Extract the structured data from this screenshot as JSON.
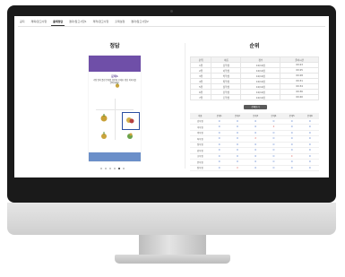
{
  "tabs": [
    {
      "label": "공지"
    },
    {
      "label": "제목/참고사항"
    },
    {
      "label": "출제정답"
    },
    {
      "label": "결과/참고사항1"
    },
    {
      "label": "제작/참고사항"
    },
    {
      "label": "출제설정"
    },
    {
      "label": "결과/참고사항2"
    }
  ],
  "left_panel": {
    "title": "정답",
    "question_title": "문제1",
    "question_text": "가장 많이 틀린 문제를 확인해 보세요. 정답 이미지를 선택하세요."
  },
  "right_panel": {
    "title": "순위",
    "rank_headers": [
      "순위",
      "이름",
      "점수",
      "풀이시간"
    ],
    "rank_rows": [
      [
        "1위",
        "김학생",
        "10/10점",
        "00:23"
      ],
      [
        "2위",
        "이학생",
        "10/10점",
        "00:25"
      ],
      [
        "3위",
        "박학생",
        "10/10점",
        "00:28"
      ],
      [
        "4위",
        "최학생",
        "10/10점",
        "00:31"
      ],
      [
        "5위",
        "정학생",
        "10/10점",
        "00:34"
      ],
      [
        "6위",
        "강학생",
        "10/10점",
        "00:36"
      ],
      [
        "7위",
        "조학생",
        "10/10점",
        "00:40"
      ]
    ],
    "more_button": "전체보기",
    "result_headers": [
      "이름",
      "문제1",
      "문제2",
      "문제3",
      "문제4",
      "문제5",
      "문제6"
    ],
    "result_rows": [
      [
        "김학생",
        "O",
        "O",
        "O",
        "O",
        "O",
        "O"
      ],
      [
        "이학생",
        "O",
        "O",
        "O",
        "X",
        "O",
        "O"
      ],
      [
        "박학생",
        "O",
        "O",
        "O",
        "O",
        "O",
        "O"
      ],
      [
        "최학생",
        "O",
        "O",
        "X",
        "O",
        "O",
        "O"
      ],
      [
        "정학생",
        "O",
        "O",
        "O",
        "O",
        "O",
        "O"
      ],
      [
        "강학생",
        "O",
        "O",
        "O",
        "O",
        "O",
        "O"
      ],
      [
        "조학생",
        "O",
        "O",
        "O",
        "O",
        "X",
        "O"
      ],
      [
        "윤학생",
        "O",
        "O",
        "O",
        "O",
        "O",
        "O"
      ],
      [
        "장학생",
        "O",
        "X",
        "O",
        "O",
        "O",
        "O"
      ]
    ]
  }
}
